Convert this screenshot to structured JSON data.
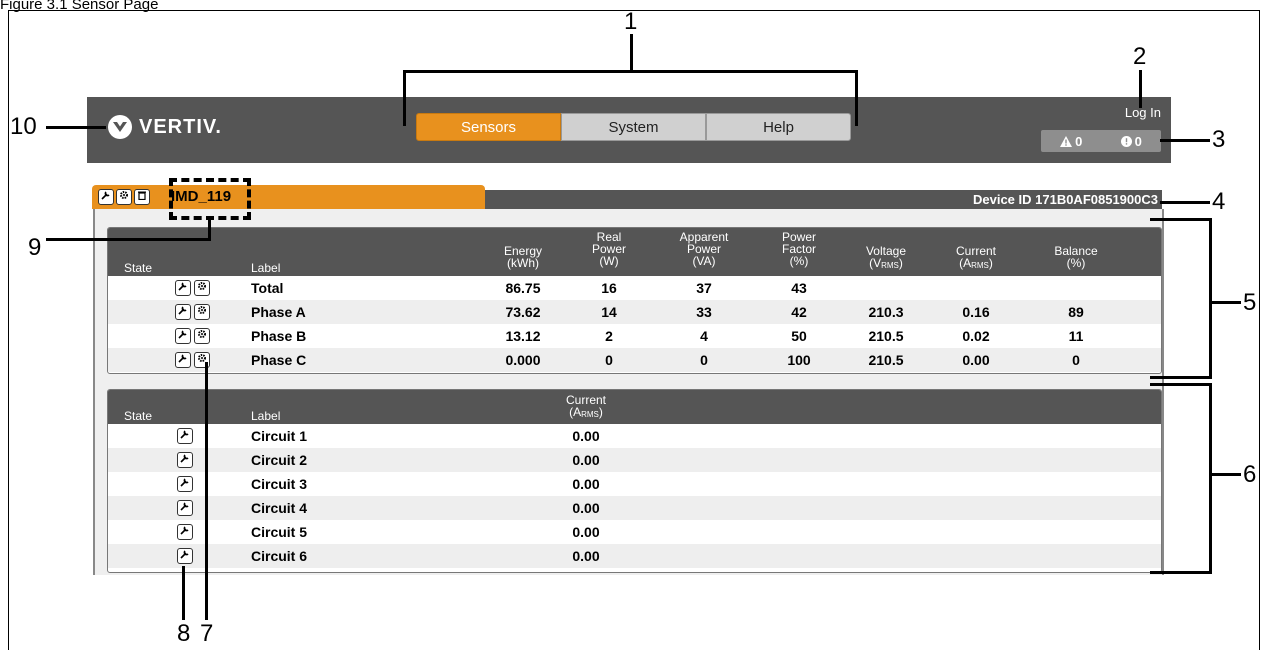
{
  "caption": "Figure 3.1 Sensor Page",
  "callouts": [
    "1",
    "2",
    "3",
    "4",
    "5",
    "6",
    "7",
    "8",
    "9",
    "10"
  ],
  "header": {
    "logo_text": "VERTIV.",
    "tabs": [
      "Sensors",
      "System",
      "Help"
    ],
    "active_tab": "Sensors",
    "login": "Log In",
    "warning_count": "0",
    "critical_count": "0"
  },
  "device": {
    "name": "IMD_119",
    "id_text": "Device ID 171B0AF0851900C3"
  },
  "phase_table": {
    "headers": {
      "state": "State",
      "label": "Label",
      "energy": [
        "Energy",
        "(kWh)"
      ],
      "real_power": [
        "Real",
        "Power",
        "(W)"
      ],
      "apparent_power": [
        "Apparent",
        "Power",
        "(VA)"
      ],
      "power_factor": [
        "Power",
        "Factor",
        "(%)"
      ],
      "voltage": [
        "Voltage",
        "(V",
        "RMS",
        ")"
      ],
      "current": [
        "Current",
        "(A",
        "RMS",
        ")"
      ],
      "balance": [
        "Balance",
        "(%)"
      ]
    },
    "rows": [
      {
        "label": "Total",
        "energy": "86.75",
        "real": "16",
        "apparent": "37",
        "pf": "43",
        "voltage": "",
        "current": "",
        "balance": ""
      },
      {
        "label": "Phase A",
        "energy": "73.62",
        "real": "14",
        "apparent": "33",
        "pf": "42",
        "voltage": "210.3",
        "current": "0.16",
        "balance": "89"
      },
      {
        "label": "Phase B",
        "energy": "13.12",
        "real": "2",
        "apparent": "4",
        "pf": "50",
        "voltage": "210.5",
        "current": "0.02",
        "balance": "11"
      },
      {
        "label": "Phase C",
        "energy": "0.000",
        "real": "0",
        "apparent": "0",
        "pf": "100",
        "voltage": "210.5",
        "current": "0.00",
        "balance": "0"
      }
    ]
  },
  "circuit_table": {
    "headers": {
      "state": "State",
      "label": "Label",
      "current": [
        "Current",
        "(A",
        "RMS",
        ")"
      ]
    },
    "rows": [
      {
        "label": "Circuit 1",
        "current": "0.00"
      },
      {
        "label": "Circuit 2",
        "current": "0.00"
      },
      {
        "label": "Circuit 3",
        "current": "0.00"
      },
      {
        "label": "Circuit 4",
        "current": "0.00"
      },
      {
        "label": "Circuit 5",
        "current": "0.00"
      },
      {
        "label": "Circuit 6",
        "current": "0.00"
      }
    ]
  },
  "colors": {
    "accent": "#e8911e",
    "header": "#555555"
  }
}
